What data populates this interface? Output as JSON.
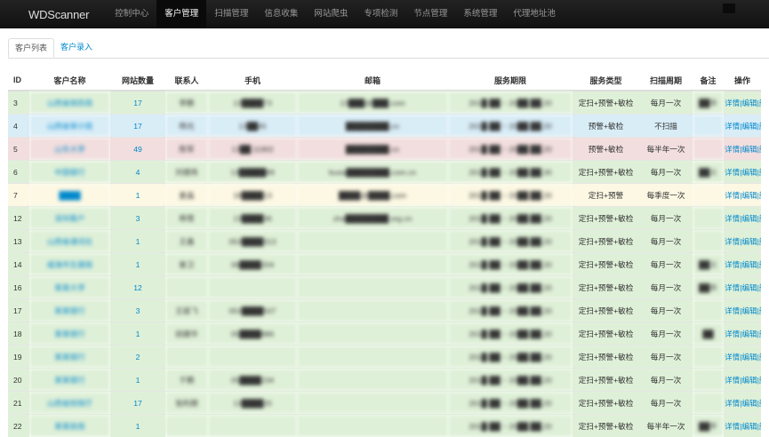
{
  "nav": {
    "brand": "WDScanner",
    "items": [
      "控制中心",
      "客户管理",
      "扫描管理",
      "信息收集",
      "网站爬虫",
      "专项检测",
      "节点管理",
      "系统管理",
      "代理地址池"
    ]
  },
  "tabs": {
    "list": "客户列表",
    "entry": "客户录入"
  },
  "table": {
    "headers": [
      "ID",
      "客户名称",
      "网站数量",
      "联系人",
      "手机",
      "邮箱",
      "服务期限",
      "服务类型",
      "扫描周期",
      "备注",
      "操作"
    ],
    "rows": [
      {
        "color": "g",
        "id": "3",
        "name": "山西省政防局",
        "sites": "17",
        "contact": "李鹏",
        "phone": "13████73",
        "email": "13███@███.com",
        "period": "201█-██ ~ 20██.██.20",
        "type": "定扫+预警+敏检",
        "cycle": "每月一次",
        "note": "██华"
      },
      {
        "color": "b",
        "id": "4",
        "name": "山西省审计局",
        "sites": "17",
        "contact": "杨光",
        "phone": "13██45",
        "email": "████████.cn",
        "period": "201█-██ ~ 20██.██.20",
        "type": "预警+敏检",
        "cycle": "不扫描",
        "note": ""
      },
      {
        "color": "r",
        "id": "5",
        "name": "山东大学",
        "sites": "49",
        "contact": "陈军",
        "phone": "13██ 11902",
        "email": "████████.cn",
        "period": "201█-██ ~ 20██.██.20",
        "type": "预警+敏检",
        "cycle": "每半年一次",
        "note": ""
      },
      {
        "color": "g",
        "id": "6",
        "name": "中国银行",
        "sites": "4",
        "contact": "刘德亮",
        "phone": "13█████89",
        "email": "liuxia████████.com.cn",
        "period": "201█-██ ~ 20██.██.30",
        "type": "定扫+预警+敏检",
        "cycle": "每月一次",
        "note": "██义"
      },
      {
        "color": "y",
        "id": "7",
        "name": "████",
        "sites": "1",
        "contact": "姜晶",
        "phone": "18████13",
        "email": "████@████.com",
        "period": "201█-██ ~ 20██.██.20",
        "type": "定扫+预警",
        "cycle": "每季度一次",
        "note": ""
      },
      {
        "color": "g",
        "id": "12",
        "name": "深圳客户",
        "sites": "3",
        "contact": "杨雪",
        "phone": "13████36",
        "email": "zha████████.org.cn",
        "period": "201█-██ ~ 20██.██.20",
        "type": "定扫+预警+敏检",
        "cycle": "每月一次",
        "note": ""
      },
      {
        "color": "g",
        "id": "13",
        "name": "山西省通讯社",
        "sites": "1",
        "contact": "王鑫",
        "phone": "053████313",
        "email": "",
        "period": "201█-██ ~ 20██.██.20",
        "type": "定扫+预警+敏检",
        "cycle": "每月一次",
        "note": ""
      },
      {
        "color": "g",
        "id": "14",
        "name": "威海市生建局",
        "sites": "1",
        "contact": "崔卫",
        "phone": "06████204",
        "email": "",
        "period": "201█-██ ~ 20██.██.20",
        "type": "定扫+预警+敏检",
        "cycle": "每月一次",
        "note": "██义"
      },
      {
        "color": "g",
        "id": "16",
        "name": "某某大学",
        "sites": "12",
        "contact": "",
        "phone": "",
        "email": "",
        "period": "201█-██ ~ 20██.██.20",
        "type": "定扫+预警+敏检",
        "cycle": "每月一次",
        "note": "██华"
      },
      {
        "color": "g",
        "id": "17",
        "name": "某某银行",
        "sites": "3",
        "contact": "王丽飞",
        "phone": "053████507",
        "email": "",
        "period": "201█-██ ~ 20██.██.20",
        "type": "定扫+预警+敏检",
        "cycle": "每月一次",
        "note": ""
      },
      {
        "color": "g",
        "id": "18",
        "name": "某某银行",
        "sites": "1",
        "contact": "田建华",
        "phone": "05████886",
        "email": "",
        "period": "201█-██ ~ 20██.██.20",
        "type": "定扫+预警+敏检",
        "cycle": "每月一次",
        "note": "██"
      },
      {
        "color": "g",
        "id": "19",
        "name": "某某银行",
        "sites": "2",
        "contact": "",
        "phone": "",
        "email": "",
        "period": "201█-██ ~ 20██.██.20",
        "type": "定扫+预警+敏检",
        "cycle": "每月一次",
        "note": ""
      },
      {
        "color": "g",
        "id": "20",
        "name": "某某银行",
        "sites": "1",
        "contact": "于鹏",
        "phone": "05████234",
        "email": "",
        "period": "201█-██ ~ 20██.██.20",
        "type": "定扫+预警+敏检",
        "cycle": "每月一次",
        "note": ""
      },
      {
        "color": "g",
        "id": "21",
        "name": "山西省财政厅",
        "sites": "17",
        "contact": "张利朋",
        "phone": "13████20",
        "email": "",
        "period": "201█-██ ~ 20██.██.20",
        "type": "定扫+预警+敏检",
        "cycle": "每月一次",
        "note": ""
      },
      {
        "color": "g",
        "id": "22",
        "name": "某某政局",
        "sites": "1",
        "contact": "",
        "phone": "",
        "email": "",
        "period": "201█-██ ~ 20██.██.20",
        "type": "定扫+预警+敏检",
        "cycle": "每半年一次",
        "note": "██平"
      }
    ],
    "ops": {
      "detail": "详情",
      "edit": "编辑",
      "delete": "删除",
      "sep": "|"
    }
  }
}
